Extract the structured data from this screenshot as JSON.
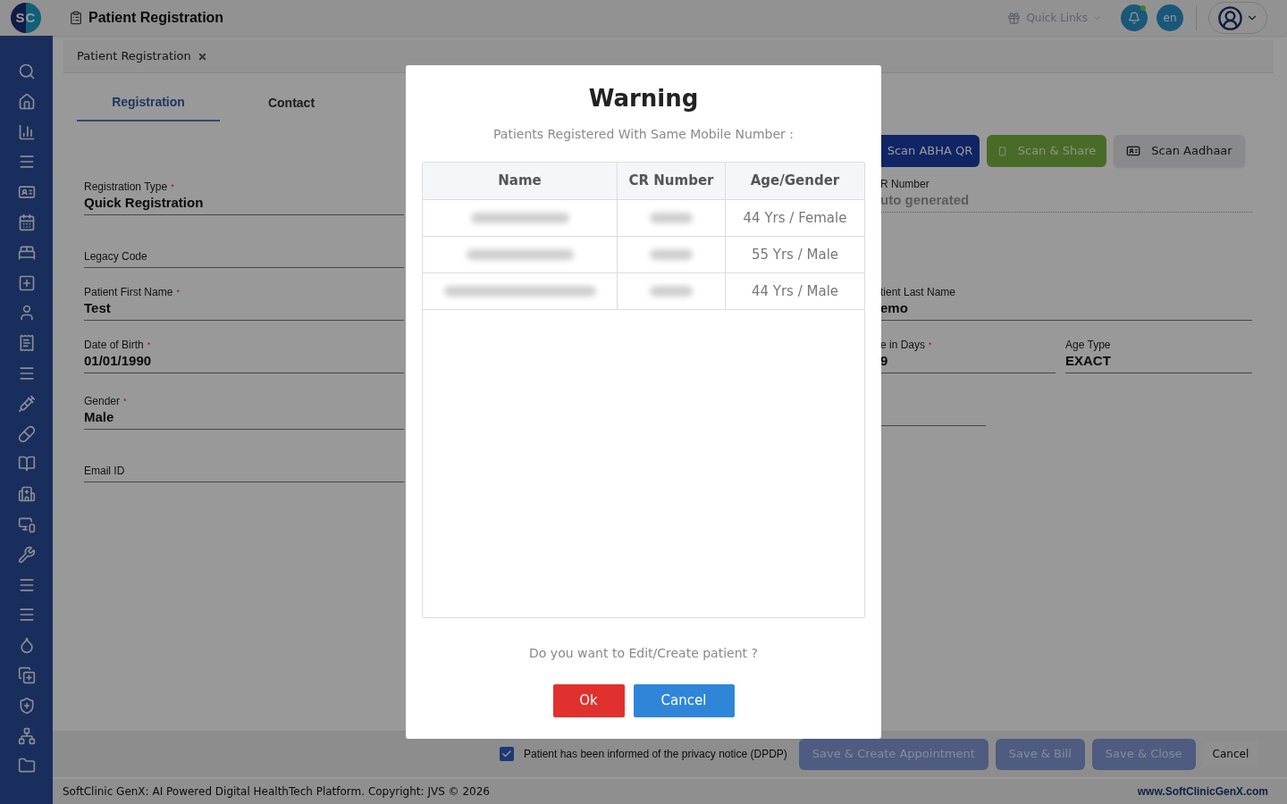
{
  "header": {
    "logo": "SC",
    "title": "Patient Registration",
    "quick_links": "Quick Links",
    "notifications": {
      "unread": true
    },
    "language": "en"
  },
  "breadcrumb_tabs": [
    {
      "label": "Patient Registration",
      "selected": true
    }
  ],
  "tabs": [
    {
      "label": "Registration",
      "selected": true
    },
    {
      "label": "Contact",
      "selected": false
    }
  ],
  "left_fields": [
    {
      "label": "Registration Type",
      "required_mark": "*",
      "value": "Quick Registration"
    },
    {
      "label": "Legacy Code"
    },
    {
      "label": "Patient First Name",
      "required_mark": "*",
      "value": "Test"
    },
    {
      "label": "Date of Birth",
      "required_mark": "*",
      "value": "01/01/1990"
    },
    {
      "label": "Gender",
      "required_mark": "*",
      "value": "Male"
    },
    {
      "label": "Email ID"
    }
  ],
  "scan_buttons": [
    {
      "label": "Scan ABHA QR",
      "kind": "abha"
    },
    {
      "label": "Scan & Share",
      "kind": "share"
    },
    {
      "label": "Scan Aadhaar",
      "kind": "aadhaar"
    }
  ],
  "right_fields": {
    "cr_number": {
      "label": "R Number",
      "placeholder": "uto generated"
    },
    "last_name": {
      "label": "tient Last Name",
      "value": "emo"
    },
    "age_in_days": {
      "label": "e in Days",
      "required_mark": "*",
      "value": "9"
    },
    "age_type": {
      "label": "Age Type",
      "value": "EXACT"
    }
  },
  "privacy": {
    "checked": true,
    "label": "Patient has been informed of the privacy notice (DPDP)"
  },
  "actions": [
    {
      "label": "Save & Create Appointment",
      "kind": "primary"
    },
    {
      "label": "Save & Bill",
      "kind": "primary"
    },
    {
      "label": "Save & Close",
      "kind": "primary"
    },
    {
      "label": "Cancel",
      "kind": "plain"
    }
  ],
  "footer": {
    "text": "SoftClinic GenX: AI Powered Digital HealthTech Platform. Copyright: JVS © 2026",
    "link": "www.SoftClinicGenX.com"
  },
  "dialog": {
    "title": "Warning",
    "subtitle": "Patients Registered With Same Mobile Number :",
    "columns": [
      "Name",
      "CR Number",
      "Age/Gender"
    ],
    "rows": [
      {
        "age_gender": "44 Yrs / Female"
      },
      {
        "age_gender": "55 Yrs / Male"
      },
      {
        "age_gender": "44 Yrs / Male"
      }
    ],
    "question": "Do you want to Edit/Create patient ?",
    "buttons": [
      {
        "label": "Ok",
        "kind": "danger"
      },
      {
        "label": "Cancel",
        "kind": "primary"
      }
    ]
  }
}
